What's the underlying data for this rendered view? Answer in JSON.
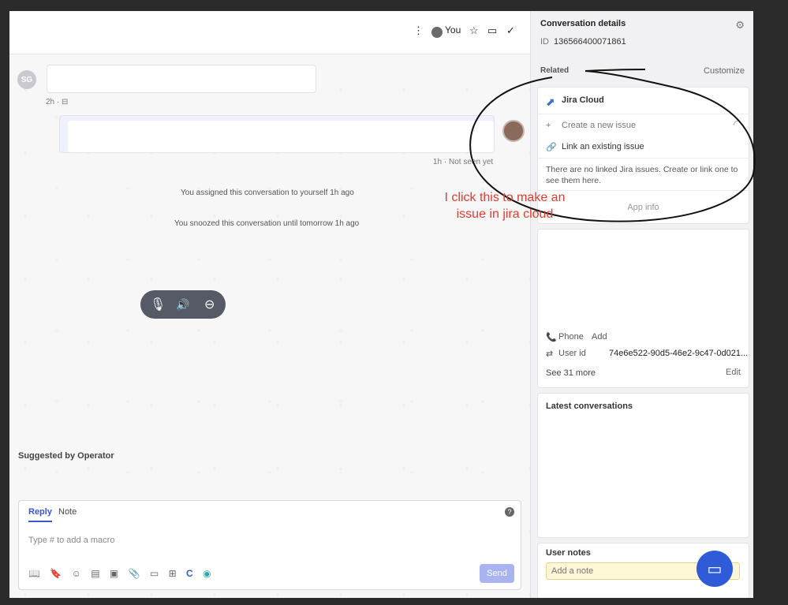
{
  "toolbar": {
    "assignee_label": "You",
    "icons": [
      "more-vertical-icon",
      "star-icon",
      "inbox-icon",
      "check-icon"
    ]
  },
  "conversation": {
    "sender_initials": "SG",
    "msg1_meta": "2h · ",
    "msg2_meta": "1h · Not seen yet",
    "system_messages": [
      "You assigned this conversation to yourself 1h ago",
      "You snoozed this conversation until tomorrow 1h ago"
    ],
    "call_controls": [
      "mute-mic-icon",
      "speaker-icon",
      "hangup-icon"
    ],
    "suggested_label": "Suggested by Operator"
  },
  "composer": {
    "tabs": [
      "Reply",
      "Note"
    ],
    "placeholder": "Type # to add a macro",
    "send_label": "Send",
    "help_label": "?",
    "tool_icons": [
      "book-icon",
      "bookmark-icon",
      "emoji-icon",
      "gif-icon",
      "image-icon",
      "attachment-icon",
      "article-icon",
      "apps-icon",
      "c-icon",
      "globe-icon"
    ]
  },
  "details": {
    "title": "Conversation details",
    "id_label": "ID",
    "id_value": "136566400071861",
    "related_label": "Related",
    "customize_label": "Customize"
  },
  "jira": {
    "title": "Jira Cloud",
    "create_label": "Create a new issue",
    "link_label": "Link an existing issue",
    "empty_text": "There are no linked Jira issues. Create or link one to see them here.",
    "app_info_label": "App info"
  },
  "attributes": {
    "phone_label": "Phone",
    "phone_value": "Add",
    "user_id_label": "User id",
    "user_id_value": "74e6e522-90d5-46e2-9c47-0d021...",
    "see_more_label": "See 31 more",
    "edit_label": "Edit"
  },
  "latest": {
    "title": "Latest conversations"
  },
  "user_notes": {
    "title": "User notes",
    "placeholder": "Add a note"
  },
  "annotation": {
    "line1": "I click this to make an",
    "line2": "issue in jira cloud"
  },
  "colors": {
    "accent": "#3c55d6",
    "annotation": "#e33b2e",
    "messenger": "#2f5bd8"
  }
}
